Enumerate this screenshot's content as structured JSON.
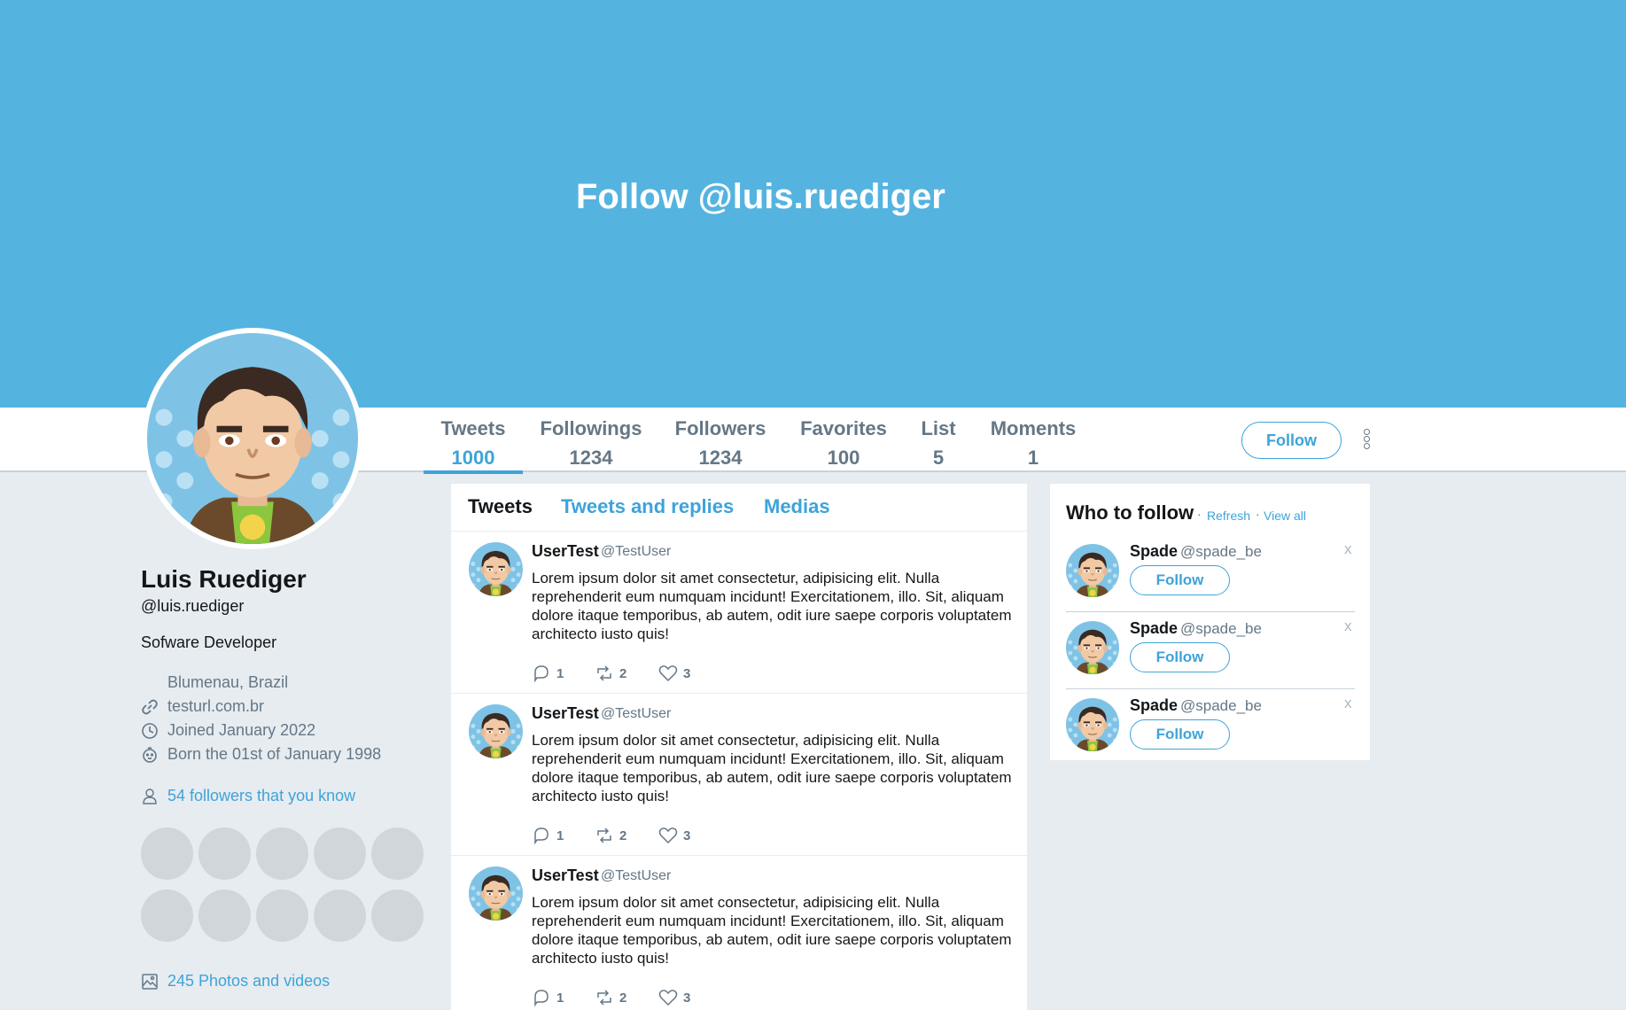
{
  "banner": {
    "title": "Follow @luis.ruediger",
    "color": "#55b3e0"
  },
  "stats": [
    {
      "label": "Tweets",
      "value": "1000"
    },
    {
      "label": "Followings",
      "value": "1234"
    },
    {
      "label": "Followers",
      "value": "1234"
    },
    {
      "label": "Favorites",
      "value": "100"
    },
    {
      "label": "List",
      "value": "5"
    },
    {
      "label": "Moments",
      "value": "1"
    }
  ],
  "header": {
    "follow_label": "Follow"
  },
  "profile": {
    "name": "Luis Ruediger",
    "handle": "@luis.ruediger",
    "bio": "Sofware Developer",
    "location": "Blumenau, Brazil",
    "website": "testurl.com.br",
    "joined": "Joined January 2022",
    "born": "Born the 01st of January 1998",
    "followers_known": "54 followers that you know",
    "photos": "245 Photos and videos"
  },
  "tabs": [
    {
      "label": "Tweets"
    },
    {
      "label": "Tweets and replies"
    },
    {
      "label": "Medias"
    }
  ],
  "tweets": [
    {
      "name": "UserTest",
      "handle": "@TestUser",
      "text": "Lorem ipsum dolor sit amet consectetur, adipisicing elit. Nulla reprehenderit eum numquam incidunt! Exercitationem, illo. Sit, aliquam dolore itaque temporibus, ab autem, odit iure saepe corporis voluptatem architecto iusto quis!",
      "replies": "1",
      "retweets": "2",
      "likes": "3"
    },
    {
      "name": "UserTest",
      "handle": "@TestUser",
      "text": "Lorem ipsum dolor sit amet consectetur, adipisicing elit. Nulla reprehenderit eum numquam incidunt! Exercitationem, illo. Sit, aliquam dolore itaque temporibus, ab autem, odit iure saepe corporis voluptatem architecto iusto quis!",
      "replies": "1",
      "retweets": "2",
      "likes": "3"
    },
    {
      "name": "UserTest",
      "handle": "@TestUser",
      "text": "Lorem ipsum dolor sit amet consectetur, adipisicing elit. Nulla reprehenderit eum numquam incidunt! Exercitationem, illo. Sit, aliquam dolore itaque temporibus, ab autem, odit iure saepe corporis voluptatem architecto iusto quis!",
      "replies": "1",
      "retweets": "2",
      "likes": "3"
    }
  ],
  "who_to_follow": {
    "title": "Who to follow",
    "refresh": "Refresh",
    "view_all": "View all",
    "close": "x",
    "suggestions": [
      {
        "name": "Spade",
        "handle": "@spade_be",
        "follow_label": "Follow"
      },
      {
        "name": "Spade",
        "handle": "@spade_be",
        "follow_label": "Follow"
      },
      {
        "name": "Spade",
        "handle": "@spade_be",
        "follow_label": "Follow"
      }
    ]
  },
  "icons": {
    "location": "map-pin-icon",
    "website": "link-icon",
    "joined": "clock-icon",
    "born": "baby-icon",
    "followers": "person-icon",
    "photos": "image-icon",
    "reply": "comment-icon",
    "retweet": "retweet-icon",
    "like": "heart-icon"
  },
  "colors": {
    "accent": "#3ea3d9",
    "muted": "#657786",
    "page_bg": "#e6ecf0"
  }
}
